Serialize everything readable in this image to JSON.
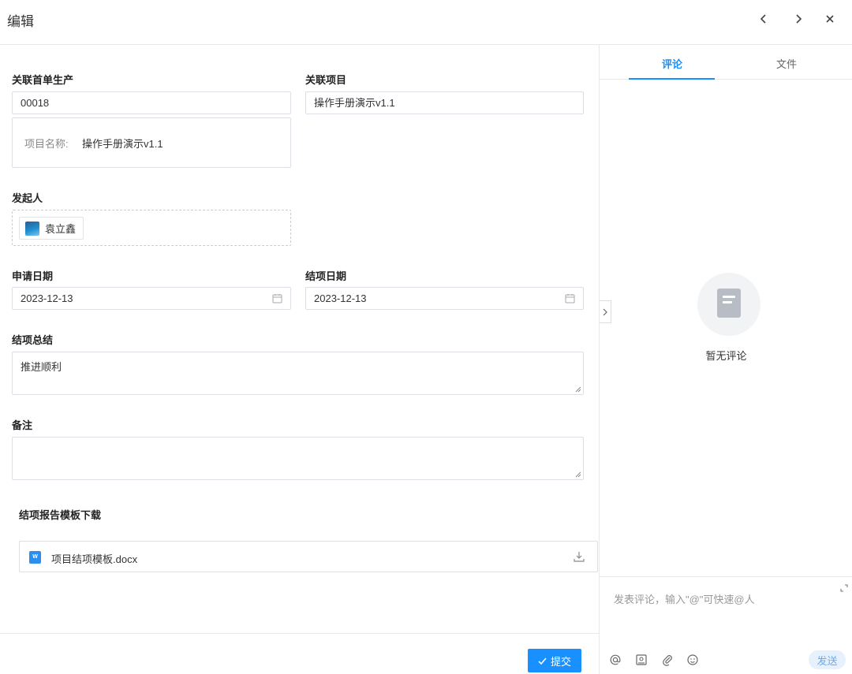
{
  "header": {
    "title": "编辑"
  },
  "form": {
    "production_order": {
      "label": "关联首单生产",
      "value": "00018",
      "info_key": "项目名称:",
      "info_value": "操作手册演示v1.1"
    },
    "project": {
      "label": "关联项目",
      "value": "操作手册演示v1.1"
    },
    "initiator": {
      "label": "发起人",
      "name": "袁立鑫"
    },
    "apply_date": {
      "label": "申请日期",
      "value": "2023-12-13"
    },
    "close_date": {
      "label": "结项日期",
      "value": "2023-12-13"
    },
    "summary": {
      "label": "结项总结",
      "value": "推进顺利"
    },
    "remark": {
      "label": "备注",
      "value": ""
    },
    "template": {
      "label": "结项报告模板下载",
      "file_badge": "W",
      "file_name": "项目结项模板.docx"
    }
  },
  "footer": {
    "submit_label": "提交"
  },
  "side": {
    "tabs": [
      {
        "label": "评论",
        "active": true
      },
      {
        "label": "文件",
        "active": false
      }
    ],
    "empty_text": "暂无评论",
    "comment_placeholder": "发表评论，输入\"@\"可快速@人",
    "send_label": "发送",
    "tools": [
      "at-icon",
      "image-icon",
      "attachment-icon",
      "emoji-icon"
    ]
  },
  "colors": {
    "accent": "#1890ff",
    "border": "#dcdfe6",
    "send_bg": "#e6f1fd"
  }
}
